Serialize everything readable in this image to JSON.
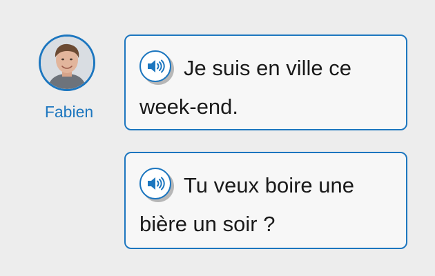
{
  "speaker": {
    "name": "Fabien"
  },
  "messages": [
    {
      "text": "Je suis en ville ce week-end."
    },
    {
      "text": "Tu veux boire une bière un soir ?"
    }
  ],
  "colors": {
    "accent": "#1c76bf",
    "background": "#ededed",
    "bubble": "#f7f7f7"
  }
}
